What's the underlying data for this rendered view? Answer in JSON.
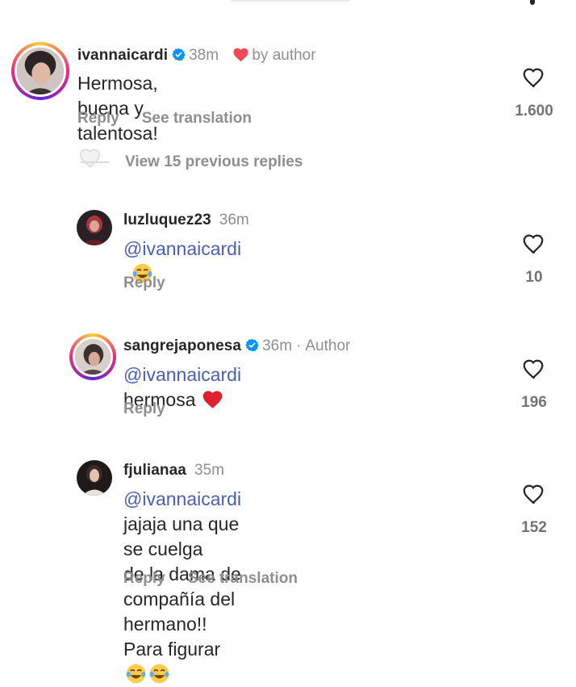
{
  "comments": [
    {
      "username": "ivannaicardi",
      "verified": true,
      "time": "38m",
      "liked_by_author_text": "by author",
      "text": "Hermosa, buena y talentosa!",
      "emoji": "white-heart",
      "reply_label": "Reply",
      "translation_label": "See translation",
      "likes": "1.600"
    },
    {
      "username": "luzluquez23",
      "time": "36m",
      "mention": "@ivannaicardi",
      "text": "",
      "emoji": "tears-of-joy",
      "reply_label": "Reply",
      "likes": "10"
    },
    {
      "username": "sangrejaponesa",
      "verified": true,
      "time": "36m",
      "separator": "·",
      "author_badge": "Author",
      "mention": "@ivannaicardi",
      "text": "hermosa",
      "emoji": "red-heart",
      "reply_label": "Reply",
      "likes": "196"
    },
    {
      "username": "fjulianaa",
      "time": "35m",
      "mention": "@ivannaicardi",
      "text_line1": "jajaja una que se cuelga",
      "text_line2": "de la dama de compañía del hermano!!",
      "text_line3": "Para figurar",
      "emoji": "tears-of-joy",
      "reply_label": "Reply",
      "translation_label": "See translation",
      "likes": "152"
    }
  ],
  "view_previous_replies": "View 15 previous replies",
  "colors": {
    "mention": "#4a5fb4",
    "secondary_text": "#8e8e8e",
    "verified": "#0095f6",
    "like_red": "#ed4956"
  }
}
